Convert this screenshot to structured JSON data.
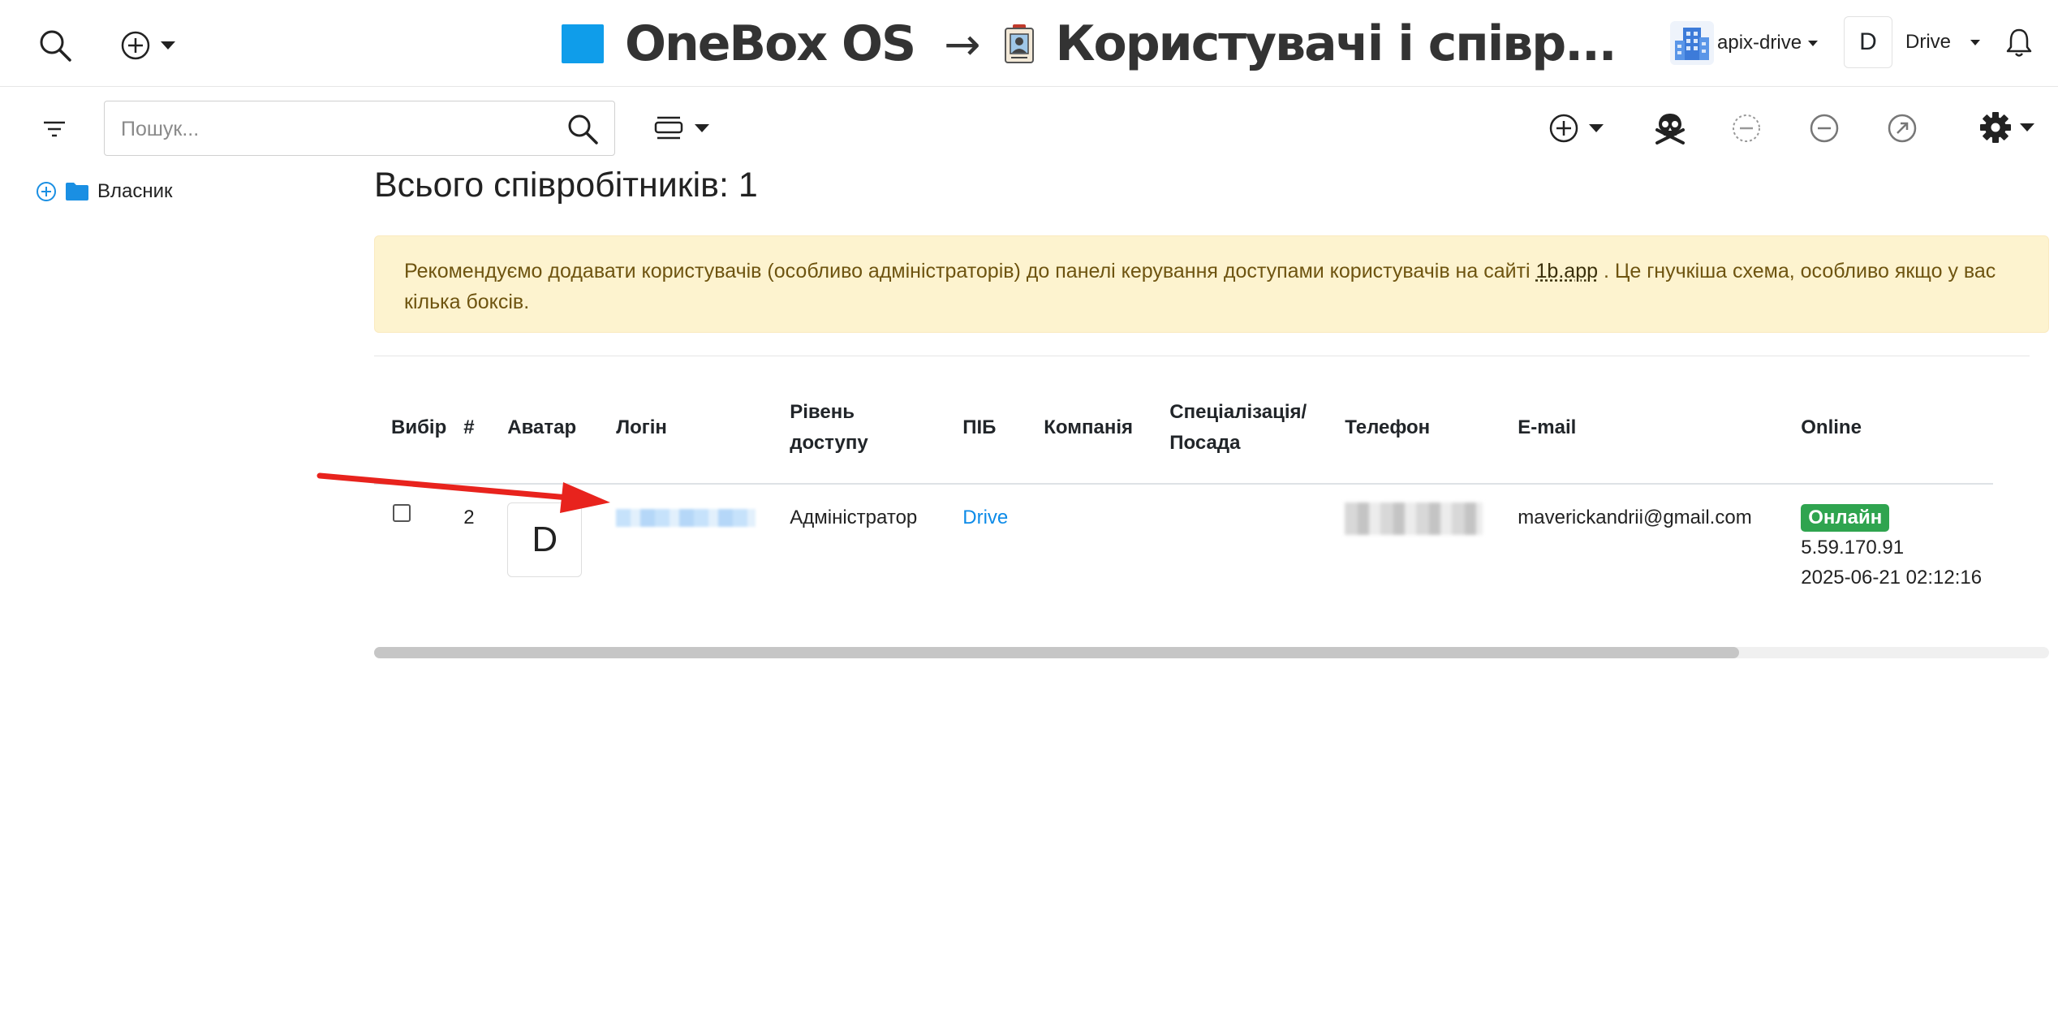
{
  "header": {
    "app_name": "OneBox OS",
    "arrow": "→",
    "section_title": "Користувачі і співр...",
    "company_name": "apix-drive",
    "user_initial": "D",
    "user_name": "Drive",
    "accent_color": "#0f9dea"
  },
  "toolbar": {
    "search_placeholder": "Пошук...",
    "icons": [
      "filter-icon",
      "search-icon",
      "view-mode-icon",
      "add-icon",
      "skull-icon",
      "minus-dashed-icon",
      "minus-icon",
      "export-arrow-icon",
      "gear-icon"
    ]
  },
  "sidebar": {
    "tree": [
      {
        "label": "Власник",
        "icon": "folder-icon"
      }
    ]
  },
  "main": {
    "count_title": "Всього співробітників: 1",
    "alert": {
      "text_before": "Рекомендуємо додавати користувачів (особливо адміністраторів) до панелі керування доступами користувачів на сайті",
      "link": "1b.app",
      "text_after": ". Це гнучкіша схема, особливо якщо у вас кілька боксів."
    },
    "table": {
      "headers": {
        "select": "Вибір",
        "num": "#",
        "avatar": "Аватар",
        "login": "Логін",
        "access_line1": "Рівень",
        "access_line2": "доступу",
        "name": "ПІБ",
        "company": "Компанія",
        "position_line1": "Спеціалізація/",
        "position_line2": "Посада",
        "phone": "Телефон",
        "email": "E-mail",
        "online": "Online"
      },
      "rows": [
        {
          "num": "2",
          "avatar_initial": "D",
          "access": "Адміністратор",
          "name": "Drive",
          "company": "",
          "position": "",
          "email": "maverickandrii@gmail.com",
          "online_status": "Онлайн",
          "ip": "5.59.170.91",
          "last_seen": "2025-06-21 02:12:16"
        }
      ]
    }
  },
  "colors": {
    "alert_bg": "#fdf3cf",
    "online_badge": "#2fa44f",
    "link": "#0d8be8",
    "annotation_arrow": "#e8231d"
  }
}
